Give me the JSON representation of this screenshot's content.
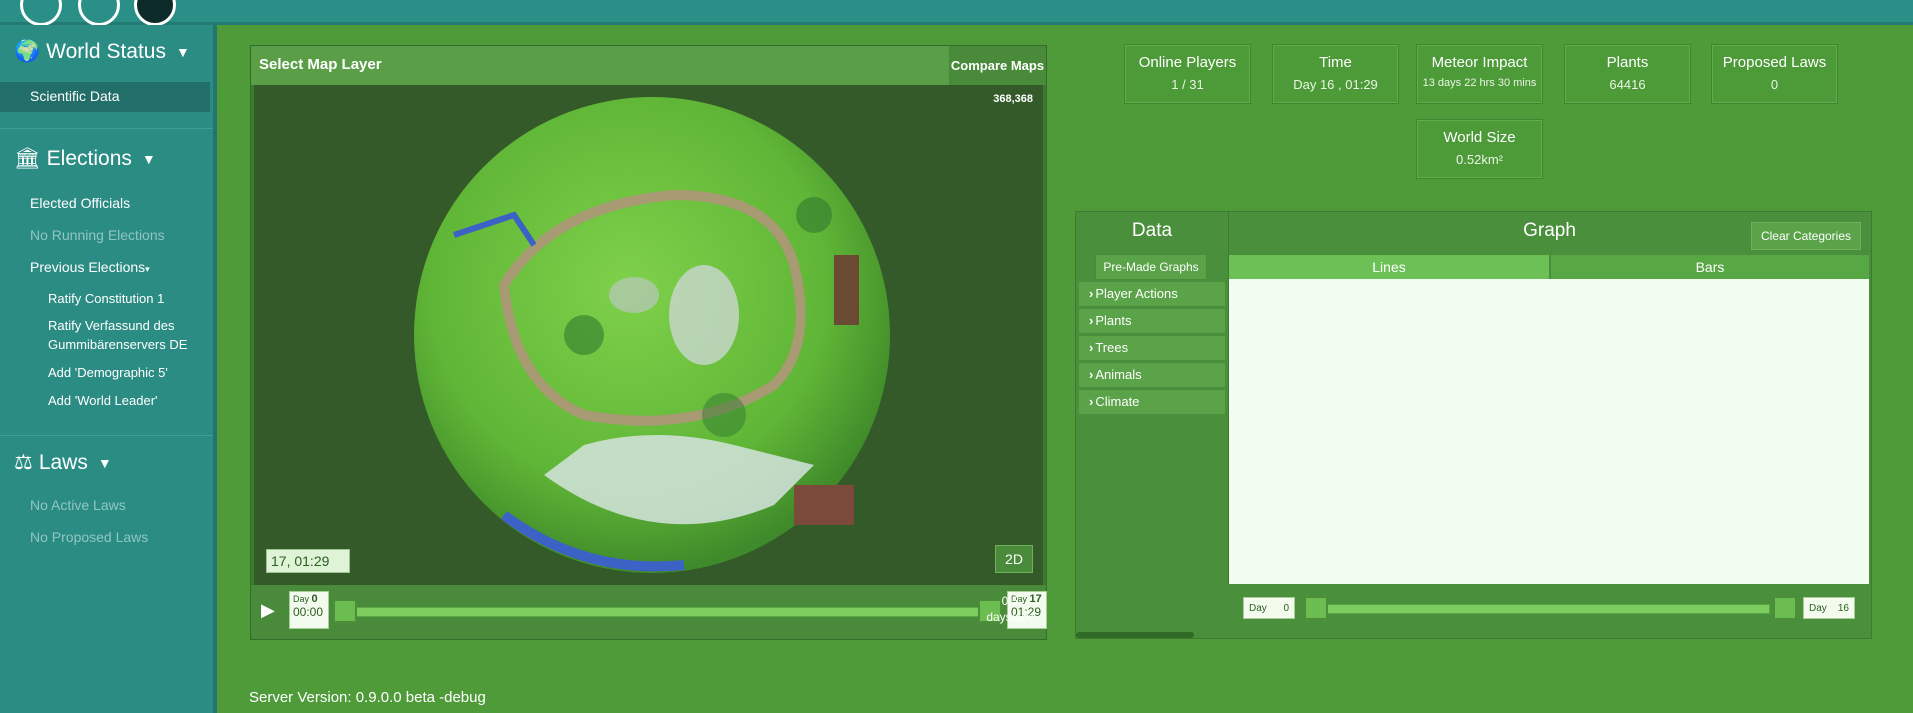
{
  "sidebar": {
    "world_status": "World Status",
    "scientific_data": "Scientific Data",
    "elections": "Elections",
    "elected_officials": "Elected Officials",
    "no_running_elections": "No Running Elections",
    "previous_elections": "Previous Elections",
    "previous_items": [
      "Ratify Constitution 1",
      "Ratify Verfassund des",
      "Gummibärenservers DE",
      "Add 'Demographic 5'",
      "Add 'World Leader'"
    ],
    "laws": "Laws",
    "no_active_laws": "No Active Laws",
    "no_proposed_laws": "No Proposed Laws"
  },
  "map": {
    "title": "Select Map Layer",
    "compare": "Compare Maps",
    "coords": "368,368",
    "time": "17, 01:29",
    "mode_button": "2D",
    "start_day_label": "Day",
    "start_day": "0",
    "start_time": "00:00",
    "end_day_label": "Day",
    "end_day": "17",
    "end_time": "01:29",
    "speed_value": "0.5",
    "speed_unit": "days/sec"
  },
  "stats": {
    "online_label": "Online Players",
    "online_value": "1 / 31",
    "time_label": "Time",
    "time_value": "Day 16 , 01:29",
    "meteor_label": "Meteor Impact",
    "meteor_value": "13 days 22 hrs 30 mins",
    "plants_label": "Plants",
    "plants_value": "64416",
    "laws_label": "Proposed Laws",
    "laws_value": "0",
    "size_label": "World Size",
    "size_value": "0.52km²"
  },
  "data_panel": {
    "title": "Data",
    "premade": "Pre-Made Graphs",
    "categories": [
      "Player Actions",
      "Plants",
      "Trees",
      "Animals",
      "Climate"
    ]
  },
  "graph": {
    "title": "Graph",
    "clear": "Clear Categories",
    "tab_lines": "Lines",
    "tab_bars": "Bars",
    "start_label": "Day",
    "start_value": "0",
    "end_label": "Day",
    "end_value": "16"
  },
  "footer": {
    "server_version": "Server Version: 0.9.0.0 beta -debug"
  },
  "colors": {
    "background": "#4f9b3a",
    "sidebar": "#2b8c84",
    "plot": "#f3fcf0"
  }
}
